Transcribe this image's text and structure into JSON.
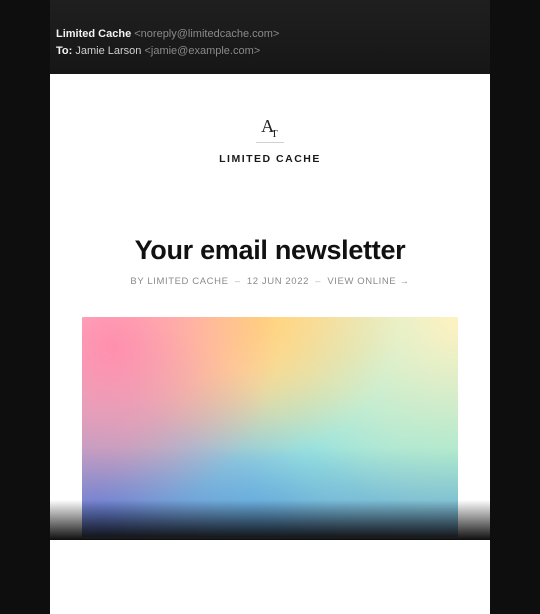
{
  "email_header": {
    "from_name": "Limited Cache",
    "from_addr": "<noreply@limitedcache.com>",
    "to_label": "To:",
    "to_name": "Jamie Larson",
    "to_addr": "<jamie@example.com>"
  },
  "publication": {
    "logo_glyph_main": "A",
    "logo_glyph_sub": "T",
    "name_caps": "LIMITED CACHE"
  },
  "article": {
    "headline": "Your email newsletter",
    "byline_prefix": "BY",
    "byline_name": "LIMITED CACHE",
    "date": "12 JUN 2022",
    "view_online_label": "VIEW ONLINE",
    "arrow": "→"
  }
}
